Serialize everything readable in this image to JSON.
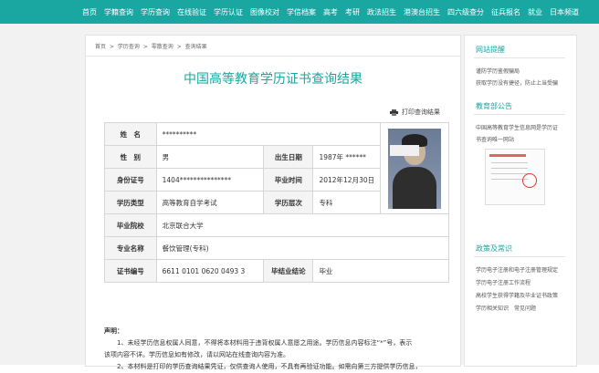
{
  "nav": [
    "首页",
    "学籍查询",
    "学历查询",
    "在线验证",
    "学历认证",
    "图像校对",
    "学信档案",
    "高考",
    "考研",
    "政法招生",
    "港澳台招生",
    "四六级查分",
    "征兵报名",
    "就业",
    "日本频道"
  ],
  "breadcrumb": [
    "首页",
    ">",
    "学历查询",
    ">",
    "零散查询",
    ">",
    "查询结果"
  ],
  "title": "中国高等教育学历证书查询结果",
  "print_label": "打印查询结果",
  "table": {
    "name_label": "姓　名",
    "name_value": "**********",
    "gender_label": "性　别",
    "gender_value": "男",
    "birth_label": "出生日期",
    "birth_value": "1987年 ******",
    "id_label": "身份证号",
    "id_value": "1404***************",
    "grad_time_label": "毕业时间",
    "grad_time_value": "2012年12月30日",
    "type_label": "学历类型",
    "type_value": "高等教育自学考试",
    "level_label": "学历层次",
    "level_value": "专科",
    "school_label": "毕业院校",
    "school_value": "北京联合大学",
    "major_label": "专业名称",
    "major_value": "餐饮管理(专科)",
    "cert_label": "证书编号",
    "cert_value": "6611 0101 0620 0493 3",
    "result_label": "毕结业结论",
    "result_value": "毕业"
  },
  "notes": {
    "heading": "声明：",
    "line1": "1、未经学历信息权属人同意，不得将本材料用于违背权属人意愿之用途。学历信息内容标注“*”号，表示",
    "line2": "该项内容不详。学历信息如有修改，请以网站在线查询内容为准。",
    "line3": "2、本材料是打印的学历查询结果凭证，仅供查询人使用，不具有再验证功能。如需向第三方提供学历信息，"
  },
  "side": {
    "s1_title": "网站提醒",
    "s1_items": [
      "谨防学历鉴假骗局",
      "获取学历没有捷径，防止上当受骗"
    ],
    "s2_title": "教育部公告",
    "s2_items": [
      "中国高等教育学生信息网是学历证",
      "书查询唯一网站"
    ],
    "s3_title": "政策及常识",
    "s3_items": [
      "学历电子注册和电子注册管理规定",
      "学历电子注册工作流程",
      "高校学生获得学籍及毕业证书政策",
      "学历相关知识　常见问题"
    ]
  }
}
